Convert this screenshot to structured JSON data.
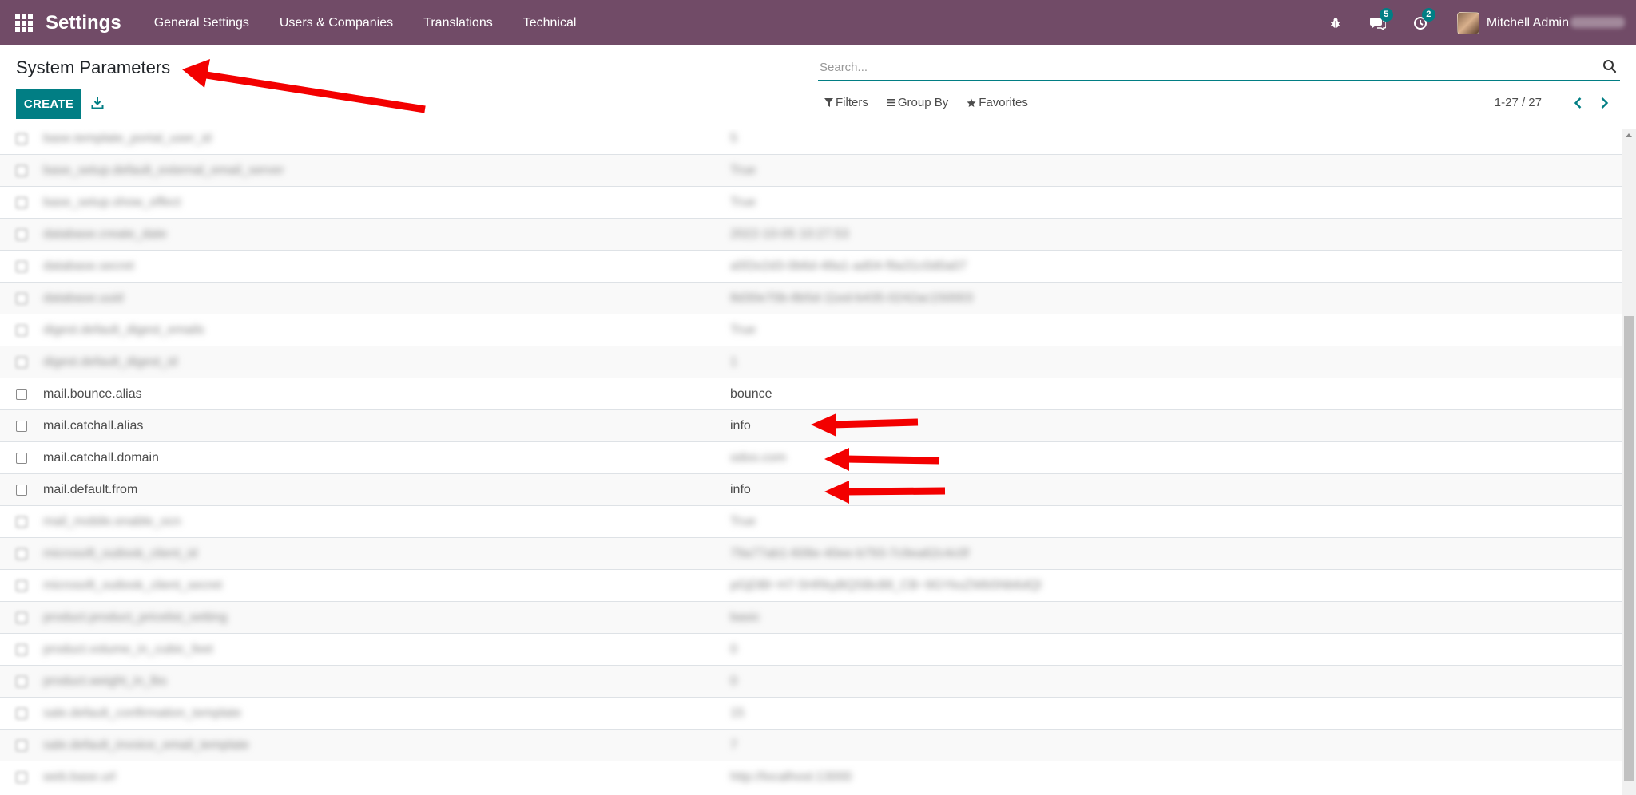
{
  "navbar": {
    "brand": "Settings",
    "menu": [
      "General Settings",
      "Users & Companies",
      "Translations",
      "Technical"
    ],
    "messages_count": "5",
    "activities_count": "2",
    "user_name": "Mitchell Admin",
    "colors": {
      "bar": "#714b67",
      "badge": "#017e84"
    }
  },
  "control_panel": {
    "title": "System Parameters",
    "search_placeholder": "Search...",
    "create_label": "CREATE",
    "filters_label": "Filters",
    "group_by_label": "Group By",
    "favorites_label": "Favorites",
    "pager_value": "1-27 / 27"
  },
  "list": {
    "rows": [
      {
        "key": "base.template_portal_user_id",
        "value": "5",
        "blurred": true
      },
      {
        "key": "base_setup.default_external_email_server",
        "value": "True",
        "blurred": true
      },
      {
        "key": "base_setup.show_effect",
        "value": "True",
        "blurred": true
      },
      {
        "key": "database.create_date",
        "value": "2022-10-05 10:27:53",
        "blurred": true
      },
      {
        "key": "database.secret",
        "value": "a5f2e2d3-0b6d-48a1-ad04-f9a31c0d0a07",
        "blurred": true
      },
      {
        "key": "database.uuid",
        "value": "8d30e70b-8b5d-11ed-b435-0242ac150003",
        "blurred": true
      },
      {
        "key": "digest.default_digest_emails",
        "value": "True",
        "blurred": true
      },
      {
        "key": "digest.default_digest_id",
        "value": "1",
        "blurred": true
      },
      {
        "key": "mail.bounce.alias",
        "value": "bounce",
        "blurred": false
      },
      {
        "key": "mail.catchall.alias",
        "value": "info",
        "blurred": false
      },
      {
        "key": "mail.catchall.domain",
        "value": "odoo.com",
        "blurred": true,
        "key_visible": true
      },
      {
        "key": "mail.default.from",
        "value": "info",
        "blurred": false
      },
      {
        "key": "mail_mobile.enable_ocn",
        "value": "True",
        "blurred": true
      },
      {
        "key": "microsoft_outlook_client_id",
        "value": "79a77ab1-608e-40ee-b793-7c9ea62c4c0f",
        "blurred": true
      },
      {
        "key": "microsoft_outlook_client_secret",
        "value": "pGjDBl~H7-5HRkyBQSBcBll_CB~9GYksZWb5Nb6dQl",
        "blurred": true
      },
      {
        "key": "product.product_pricelist_setting",
        "value": "basic",
        "blurred": true
      },
      {
        "key": "product.volume_in_cubic_feet",
        "value": "0",
        "blurred": true
      },
      {
        "key": "product.weight_in_lbs",
        "value": "0",
        "blurred": true
      },
      {
        "key": "sale.default_confirmation_template",
        "value": "15",
        "blurred": true
      },
      {
        "key": "sale.default_invoice_email_template",
        "value": "7",
        "blurred": true
      },
      {
        "key": "web.base.url",
        "value": "http://localhost:13000",
        "blurred": true
      }
    ]
  }
}
